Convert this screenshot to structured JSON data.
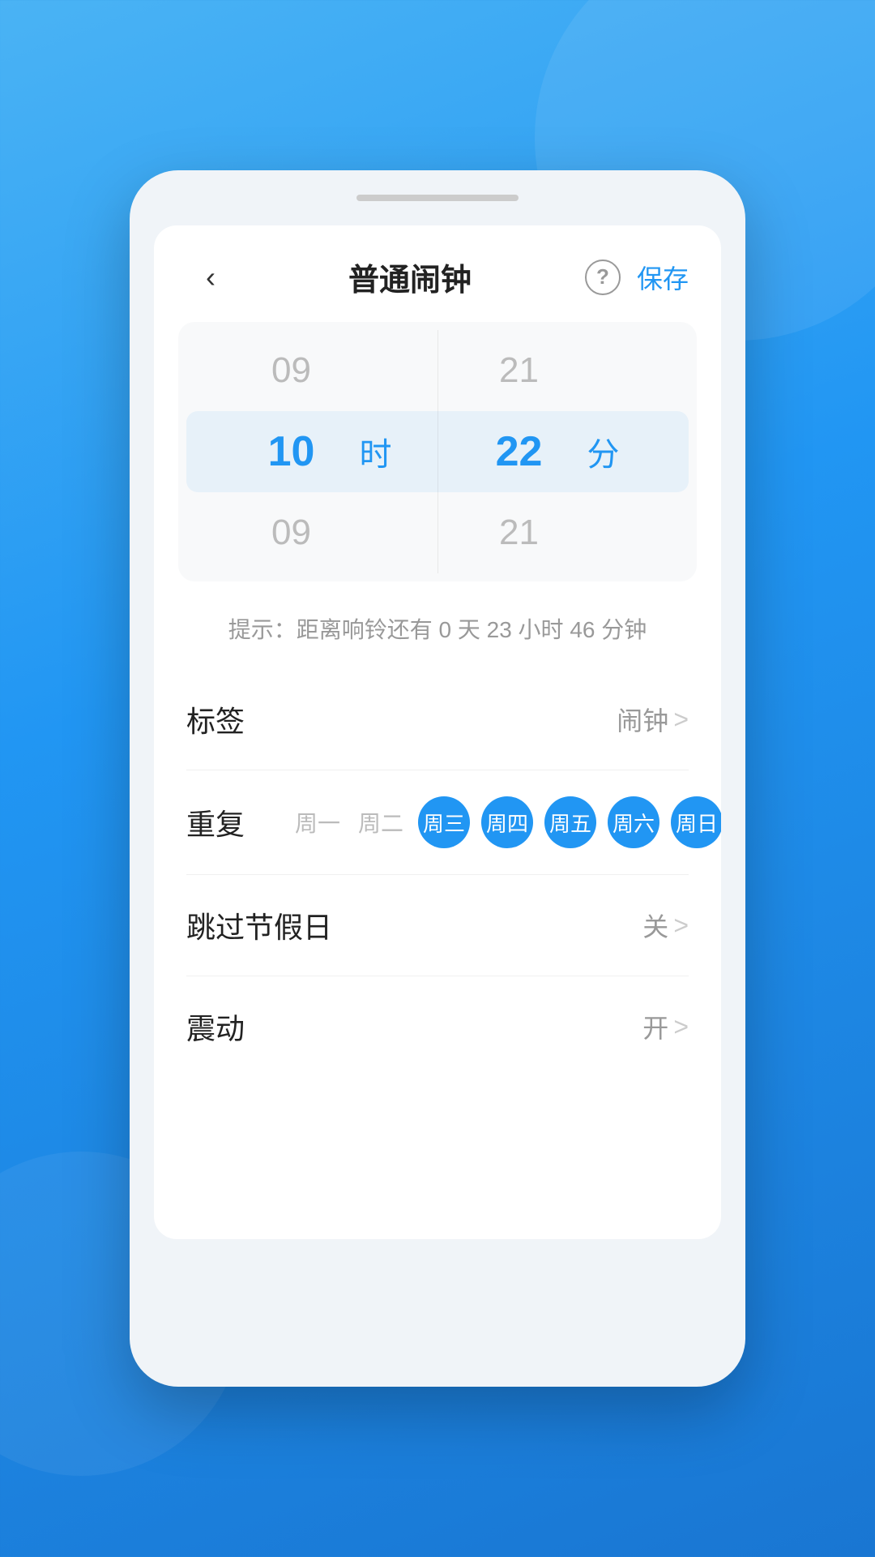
{
  "background": {
    "gradient_start": "#4ab3f4",
    "gradient_end": "#1976d2"
  },
  "header": {
    "back_label": "‹",
    "title": "普通闹钟",
    "help_icon": "?",
    "save_label": "保存"
  },
  "time_picker": {
    "hour_above": "09",
    "hour_active": "10",
    "hour_label_active": "时",
    "hour_below": "09",
    "minute_above": "21",
    "minute_active": "22",
    "minute_label_active": "分",
    "minute_below": "21"
  },
  "hint": {
    "text": "提示：距离响铃还有 0 天 23 小时 46 分钟"
  },
  "settings": {
    "label_label": "标签",
    "label_value": "闹钟",
    "repeat_label": "重复",
    "days": [
      {
        "name": "周一",
        "active": false
      },
      {
        "name": "周二",
        "active": false
      },
      {
        "name": "周三",
        "active": true
      },
      {
        "name": "周四",
        "active": true
      },
      {
        "name": "周五",
        "active": true
      },
      {
        "name": "周六",
        "active": true
      },
      {
        "name": "周日",
        "active": true
      }
    ],
    "holiday_label": "跳过节假日",
    "holiday_value": "关",
    "vibrate_label": "震动",
    "vibrate_value": "开",
    "chevron": ">"
  }
}
